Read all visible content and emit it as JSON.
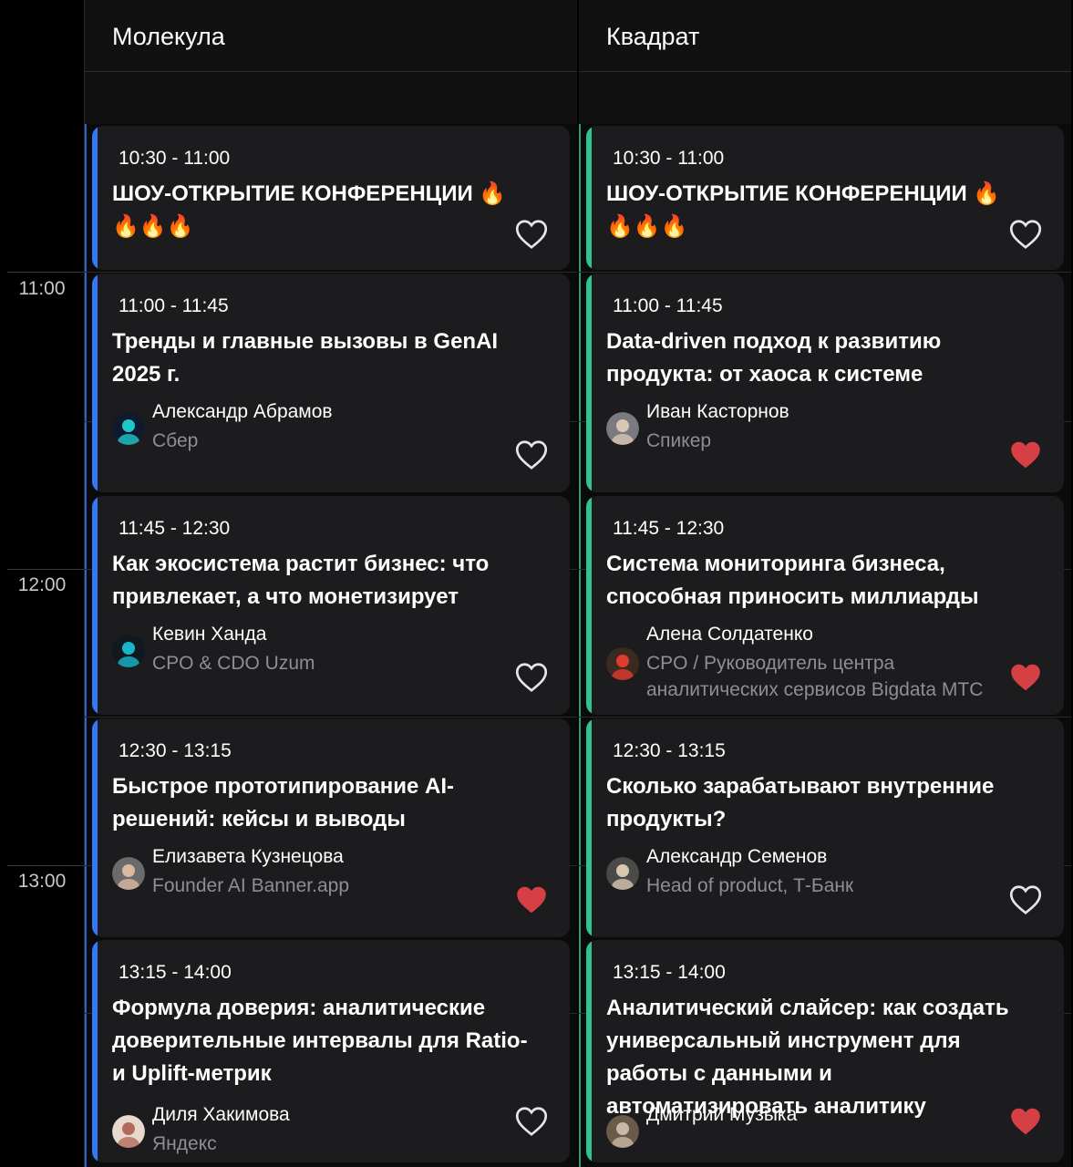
{
  "time_axis": {
    "labels": [
      "11:00",
      "12:00",
      "13:00"
    ]
  },
  "rooms": [
    {
      "name": "Молекула",
      "accent": "#3478f6",
      "sessions": [
        {
          "time": "10:30 - 11:00",
          "title": "ШОУ-ОТКРЫТИЕ КОНФЕРЕНЦИИ 🔥🔥🔥🔥",
          "favorited": false
        },
        {
          "time": "11:00 - 11:45",
          "title": "Тренды и главные вызовы в GenAI 2025 г.",
          "speaker": {
            "name": "Александр Абрамов",
            "role": "Сбер"
          },
          "favorited": false
        },
        {
          "time": "11:45 - 12:30",
          "title": "Как экосистема растит бизнес: что привлекает, а что монетизирует",
          "speaker": {
            "name": "Кевин Ханда",
            "role": "CPO & CDO Uzum"
          },
          "favorited": false
        },
        {
          "time": "12:30 - 13:15",
          "title": "Быстрое прототипирование AI-решений: кейсы и выводы",
          "speaker": {
            "name": "Елизавета Кузнецова",
            "role": "Founder AI Banner.app"
          },
          "favorited": true
        },
        {
          "time": "13:15 - 14:00",
          "title": "Формула доверия: аналитические доверительные интервалы для Ratio- и Uplift-метрик",
          "speaker": {
            "name": "Диля Хакимова",
            "role": "Яндекс"
          },
          "favorited": false
        }
      ]
    },
    {
      "name": "Квадрат",
      "accent": "#30c48d",
      "sessions": [
        {
          "time": "10:30 - 11:00",
          "title": "ШОУ-ОТКРЫТИЕ КОНФЕРЕНЦИИ 🔥🔥🔥🔥",
          "favorited": false
        },
        {
          "time": "11:00 - 11:45",
          "title": "Data-driven подход к развитию продукта: от хаоса к системе",
          "speaker": {
            "name": "Иван Касторнов",
            "role": "Спикер"
          },
          "favorited": true
        },
        {
          "time": "11:45 - 12:30",
          "title": "Система мониторинга бизнеса, способная приносить миллиарды",
          "speaker": {
            "name": "Алена Солдатенко",
            "role": "CPO / Руководитель центра аналитических сервисов Bigdata МТС"
          },
          "favorited": true
        },
        {
          "time": "12:30 - 13:15",
          "title": "Сколько зарабатывают внутренние продукты?",
          "speaker": {
            "name": "Александр Семенов",
            "role": "Head of product, Т-Банк"
          },
          "favorited": false
        },
        {
          "time": "13:15 - 14:00",
          "title": "Аналитический слайсер: как создать универсальный инструмент для работы с данными и автоматизировать аналитику",
          "speaker": {
            "name": "Дмитрий Музыка",
            "role": ""
          },
          "favorited": true
        }
      ]
    }
  ],
  "colors": {
    "heart_active": "#d64045",
    "heart_outline": "#e5e5ea"
  }
}
